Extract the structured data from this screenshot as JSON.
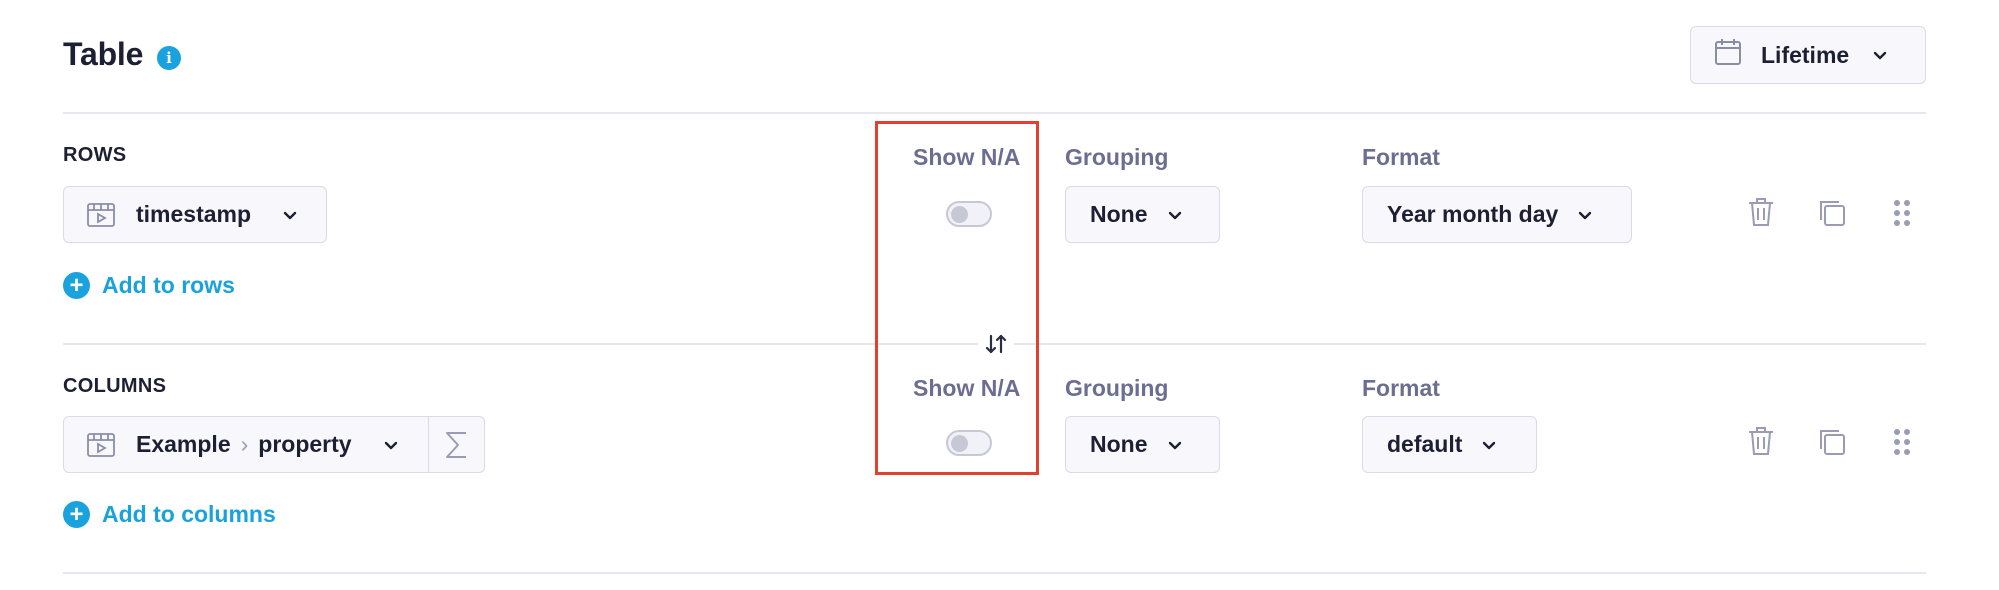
{
  "header": {
    "title": "Table",
    "info_icon": "info-icon",
    "date_range": {
      "label": "Lifetime",
      "icon": "calendar-icon"
    }
  },
  "rows": {
    "section_label": "ROWS",
    "show_na_label": "Show N/A",
    "show_na_enabled": false,
    "grouping_label": "Grouping",
    "format_label": "Format",
    "field": {
      "name": "timestamp",
      "icon": "video-event-icon"
    },
    "grouping_value": "None",
    "format_value": "Year month day",
    "add_label": "Add to rows"
  },
  "columns": {
    "section_label": "COLUMNS",
    "show_na_label": "Show N/A",
    "show_na_enabled": false,
    "grouping_label": "Grouping",
    "format_label": "Format",
    "field": {
      "event": "Example",
      "separator": "›",
      "property": "property",
      "icon": "video-event-icon",
      "aggregate_icon": "sigma-icon"
    },
    "grouping_value": "None",
    "format_value": "default",
    "add_label": "Add to columns"
  },
  "swap_icon": "swap-arrows-icon",
  "colors": {
    "accent": "#1aa2de",
    "highlight": "#e1422f",
    "text_primary": "#1d1f33",
    "text_muted": "#6b6e91",
    "border": "#d9dbe6"
  }
}
